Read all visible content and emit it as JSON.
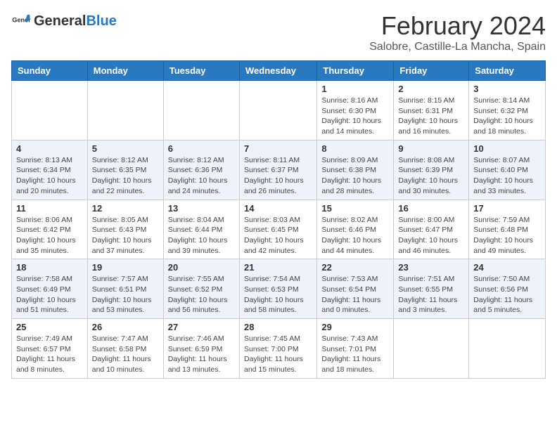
{
  "header": {
    "logo_general": "General",
    "logo_blue": "Blue",
    "month_title": "February 2024",
    "location": "Salobre, Castille-La Mancha, Spain"
  },
  "weekdays": [
    "Sunday",
    "Monday",
    "Tuesday",
    "Wednesday",
    "Thursday",
    "Friday",
    "Saturday"
  ],
  "weeks": [
    [
      {
        "day": "",
        "info": ""
      },
      {
        "day": "",
        "info": ""
      },
      {
        "day": "",
        "info": ""
      },
      {
        "day": "",
        "info": ""
      },
      {
        "day": "1",
        "info": "Sunrise: 8:16 AM\nSunset: 6:30 PM\nDaylight: 10 hours and 14 minutes."
      },
      {
        "day": "2",
        "info": "Sunrise: 8:15 AM\nSunset: 6:31 PM\nDaylight: 10 hours and 16 minutes."
      },
      {
        "day": "3",
        "info": "Sunrise: 8:14 AM\nSunset: 6:32 PM\nDaylight: 10 hours and 18 minutes."
      }
    ],
    [
      {
        "day": "4",
        "info": "Sunrise: 8:13 AM\nSunset: 6:34 PM\nDaylight: 10 hours and 20 minutes."
      },
      {
        "day": "5",
        "info": "Sunrise: 8:12 AM\nSunset: 6:35 PM\nDaylight: 10 hours and 22 minutes."
      },
      {
        "day": "6",
        "info": "Sunrise: 8:12 AM\nSunset: 6:36 PM\nDaylight: 10 hours and 24 minutes."
      },
      {
        "day": "7",
        "info": "Sunrise: 8:11 AM\nSunset: 6:37 PM\nDaylight: 10 hours and 26 minutes."
      },
      {
        "day": "8",
        "info": "Sunrise: 8:09 AM\nSunset: 6:38 PM\nDaylight: 10 hours and 28 minutes."
      },
      {
        "day": "9",
        "info": "Sunrise: 8:08 AM\nSunset: 6:39 PM\nDaylight: 10 hours and 30 minutes."
      },
      {
        "day": "10",
        "info": "Sunrise: 8:07 AM\nSunset: 6:40 PM\nDaylight: 10 hours and 33 minutes."
      }
    ],
    [
      {
        "day": "11",
        "info": "Sunrise: 8:06 AM\nSunset: 6:42 PM\nDaylight: 10 hours and 35 minutes."
      },
      {
        "day": "12",
        "info": "Sunrise: 8:05 AM\nSunset: 6:43 PM\nDaylight: 10 hours and 37 minutes."
      },
      {
        "day": "13",
        "info": "Sunrise: 8:04 AM\nSunset: 6:44 PM\nDaylight: 10 hours and 39 minutes."
      },
      {
        "day": "14",
        "info": "Sunrise: 8:03 AM\nSunset: 6:45 PM\nDaylight: 10 hours and 42 minutes."
      },
      {
        "day": "15",
        "info": "Sunrise: 8:02 AM\nSunset: 6:46 PM\nDaylight: 10 hours and 44 minutes."
      },
      {
        "day": "16",
        "info": "Sunrise: 8:00 AM\nSunset: 6:47 PM\nDaylight: 10 hours and 46 minutes."
      },
      {
        "day": "17",
        "info": "Sunrise: 7:59 AM\nSunset: 6:48 PM\nDaylight: 10 hours and 49 minutes."
      }
    ],
    [
      {
        "day": "18",
        "info": "Sunrise: 7:58 AM\nSunset: 6:49 PM\nDaylight: 10 hours and 51 minutes."
      },
      {
        "day": "19",
        "info": "Sunrise: 7:57 AM\nSunset: 6:51 PM\nDaylight: 10 hours and 53 minutes."
      },
      {
        "day": "20",
        "info": "Sunrise: 7:55 AM\nSunset: 6:52 PM\nDaylight: 10 hours and 56 minutes."
      },
      {
        "day": "21",
        "info": "Sunrise: 7:54 AM\nSunset: 6:53 PM\nDaylight: 10 hours and 58 minutes."
      },
      {
        "day": "22",
        "info": "Sunrise: 7:53 AM\nSunset: 6:54 PM\nDaylight: 11 hours and 0 minutes."
      },
      {
        "day": "23",
        "info": "Sunrise: 7:51 AM\nSunset: 6:55 PM\nDaylight: 11 hours and 3 minutes."
      },
      {
        "day": "24",
        "info": "Sunrise: 7:50 AM\nSunset: 6:56 PM\nDaylight: 11 hours and 5 minutes."
      }
    ],
    [
      {
        "day": "25",
        "info": "Sunrise: 7:49 AM\nSunset: 6:57 PM\nDaylight: 11 hours and 8 minutes."
      },
      {
        "day": "26",
        "info": "Sunrise: 7:47 AM\nSunset: 6:58 PM\nDaylight: 11 hours and 10 minutes."
      },
      {
        "day": "27",
        "info": "Sunrise: 7:46 AM\nSunset: 6:59 PM\nDaylight: 11 hours and 13 minutes."
      },
      {
        "day": "28",
        "info": "Sunrise: 7:45 AM\nSunset: 7:00 PM\nDaylight: 11 hours and 15 minutes."
      },
      {
        "day": "29",
        "info": "Sunrise: 7:43 AM\nSunset: 7:01 PM\nDaylight: 11 hours and 18 minutes."
      },
      {
        "day": "",
        "info": ""
      },
      {
        "day": "",
        "info": ""
      }
    ]
  ]
}
